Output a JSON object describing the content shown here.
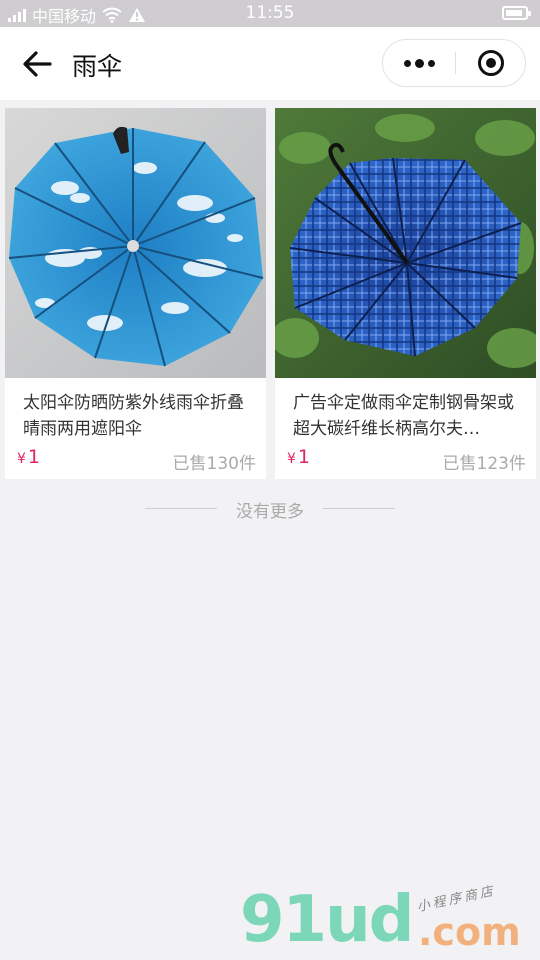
{
  "status_bar": {
    "carrier": "中国移动",
    "time": "11:55"
  },
  "nav": {
    "title": "雨伞"
  },
  "products": [
    {
      "title": "太阳伞防晒防紫外线雨伞折叠晴雨两用遮阳伞",
      "currency": "¥",
      "price": "1",
      "sold": "已售130件"
    },
    {
      "title": "广告伞定做雨伞定制钢骨架或超大碳纤维长柄高尔夫…",
      "currency": "¥",
      "price": "1",
      "sold": "已售123件"
    }
  ],
  "footer": {
    "no_more": "没有更多"
  },
  "watermark": {
    "main": "91ud",
    "com": ".com",
    "tagline": "小程序商店"
  },
  "colors": {
    "price": "#e0245e",
    "background": "#f2f1f4",
    "status_bar": "#cfcdd0"
  },
  "icons": [
    "back-arrow-icon",
    "more-dots-icon",
    "close-target-icon",
    "wifi-icon",
    "warning-icon",
    "battery-icon",
    "signal-icon"
  ]
}
